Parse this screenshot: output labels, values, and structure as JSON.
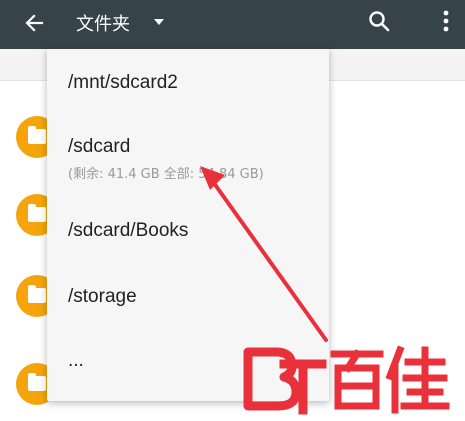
{
  "appbar": {
    "title": "文件夹",
    "icons": {
      "back": "arrow-back-icon",
      "dropdown": "caret-down-icon",
      "search": "search-icon",
      "more": "more-vert-icon"
    }
  },
  "menu": {
    "items": [
      {
        "label": "/mnt/sdcard2"
      },
      {
        "label": "/sdcard",
        "sub": "(剩余: 41.4 GB 全部: 54.84 GB)"
      },
      {
        "label": "/sdcard/Books"
      },
      {
        "label": "/storage"
      },
      {
        "label": "..."
      }
    ]
  },
  "watermark": {
    "logo": "BT百佳"
  },
  "colors": {
    "appbar": "#364349",
    "folder": "#f5a50b",
    "annotation": "#e8313a",
    "watermark": "#e8313a"
  }
}
